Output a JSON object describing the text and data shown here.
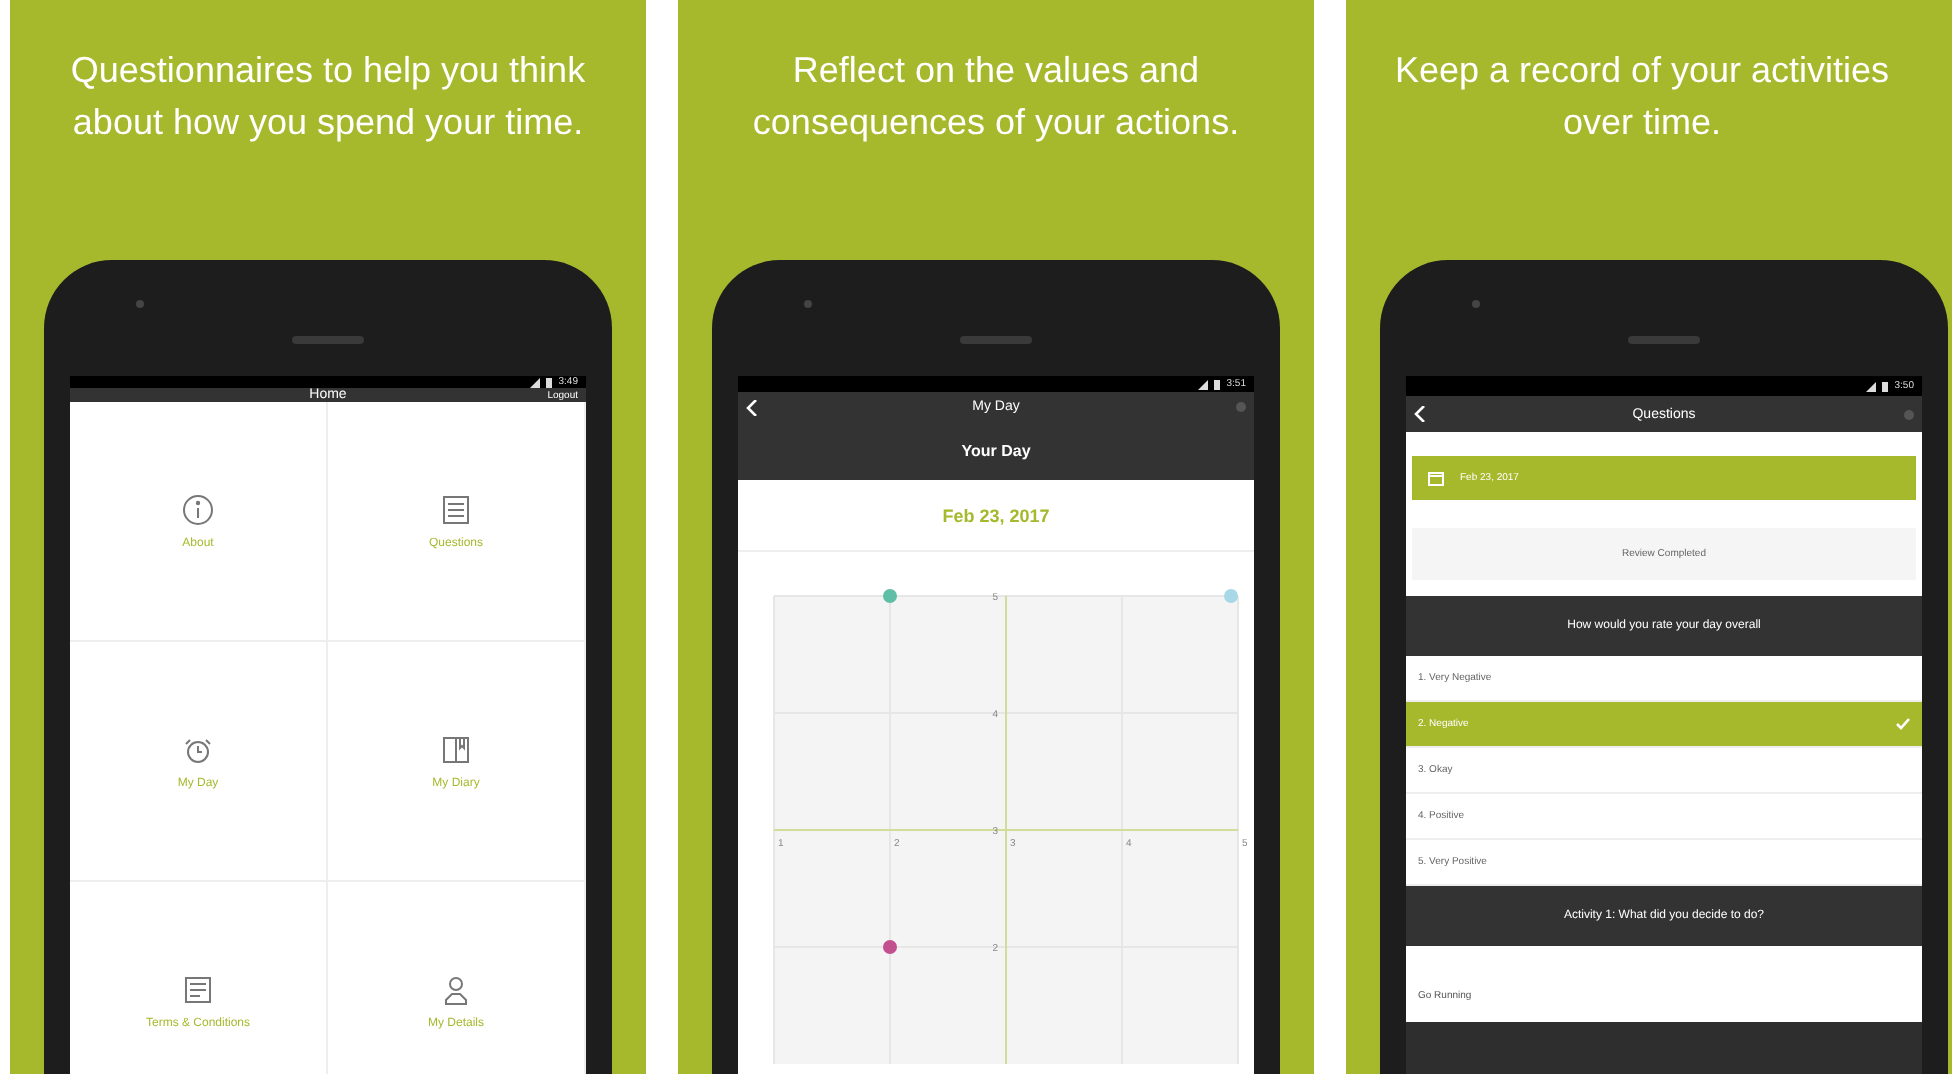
{
  "panels": [
    {
      "caption": "Questionnaires to help you think about how you spend your time.",
      "screen": {
        "kind": "home",
        "status_time": "3:49",
        "title": "Home",
        "action": "Logout",
        "tiles": [
          {
            "label": "About"
          },
          {
            "label": "Questions"
          },
          {
            "label": "My Day"
          },
          {
            "label": "My Diary"
          },
          {
            "label": "Terms & Conditions"
          },
          {
            "label": "My Details"
          }
        ]
      }
    },
    {
      "caption": "Reflect on the values and consequences of your actions.",
      "screen": {
        "kind": "chart",
        "status_time": "3:51",
        "title": "My Day",
        "heading": "Your Day",
        "date": "Feb 23, 2017",
        "chart_data": {
          "type": "scatter",
          "categories": [
            "1",
            "2",
            "3",
            "4",
            "5"
          ],
          "ylim": [
            1,
            5
          ],
          "yticks": [
            2,
            3,
            4,
            5
          ],
          "series": [
            {
              "color": "#5fbfa6",
              "values": [
                null,
                5,
                null,
                null,
                null
              ]
            },
            {
              "color": "#a8d8e8",
              "values": [
                null,
                null,
                null,
                null,
                5
              ]
            },
            {
              "color": "#c2508e",
              "values": [
                null,
                2,
                null,
                null,
                null
              ]
            }
          ]
        }
      }
    },
    {
      "caption": "Keep a record of your activities over time.",
      "screen": {
        "kind": "questions",
        "status_time": "3:50",
        "title": "Questions",
        "date": "Feb 23, 2017",
        "status": "Review Completed",
        "question": "How would you rate your day overall",
        "options": [
          {
            "label": "1. Very Negative",
            "selected": false
          },
          {
            "label": "2. Negative",
            "selected": true
          },
          {
            "label": "3. Okay",
            "selected": false
          },
          {
            "label": "4. Positive",
            "selected": false
          },
          {
            "label": "5. Very Positive",
            "selected": false
          }
        ],
        "activity_question": "Activity 1: What did you decide to do?",
        "activity_answer": "Go Running"
      }
    }
  ]
}
